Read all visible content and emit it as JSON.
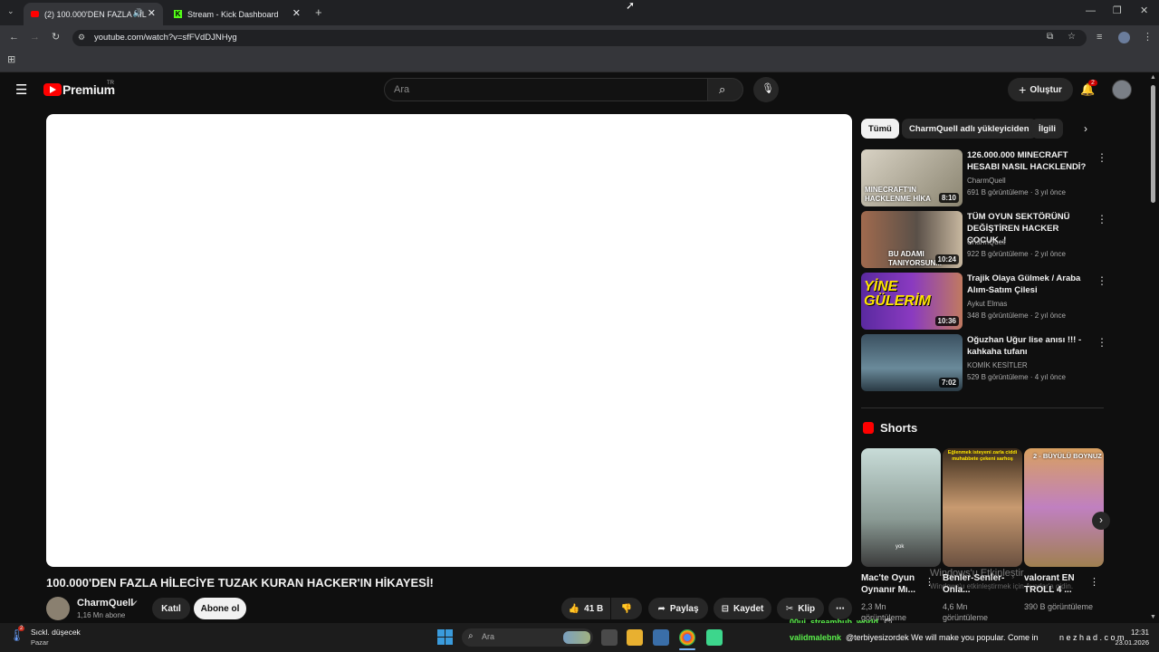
{
  "browser": {
    "tabs": [
      {
        "title": "(2) 100.000'DEN FAZLA HİL"
      },
      {
        "title": "Stream - Kick Dashboard"
      }
    ],
    "url": "youtube.com/watch?v=sfFVdDJNHyg"
  },
  "youtube": {
    "logo_text": "Premium",
    "logo_sup": "TR",
    "search_placeholder": "Ara",
    "create_label": "Oluştur",
    "notif_count": "2",
    "video": {
      "title": "100.000'DEN FAZLA HİLECİYE TUZAK KURAN HACKER'IN HİKAYESİ!",
      "channel": "CharmQuell",
      "subscribers": "1,16 Mn abone",
      "join_label": "Katıl",
      "subscribe_label": "Abone ol",
      "likes": "41 B",
      "share_label": "Paylaş",
      "save_label": "Kaydet",
      "clip_label": "Klip"
    },
    "chips": [
      "Tümü",
      "CharmQuell adlı yükleyiciden",
      "İlgili"
    ],
    "recommendations": [
      {
        "title": "126.000.000 MINECRAFT HESABI NASIL HACKLENDİ?",
        "channel": "CharmQuell",
        "meta": "691 B görüntüleme · 3 yıl önce",
        "duration": "8:10",
        "thumb_text": "MINECRAFT'IN HACKLENME HİKA"
      },
      {
        "title": "TÜM OYUN SEKTÖRÜNÜ DEĞİŞTİREN HACKER ÇOCUK..!",
        "channel": "CharmQuell",
        "meta": "922 B görüntüleme · 2 yıl önce",
        "duration": "10:24",
        "thumb_text": "BU ADAMI TANIYORSUN..."
      },
      {
        "title": "Trajik Olaya Gülmek / Araba Alım-Satım Çilesi",
        "channel": "Aykut Elmas",
        "meta": "348 B görüntüleme · 2 yıl önce",
        "duration": "10:36",
        "thumb_text": "YİNE GÜLERİM"
      },
      {
        "title": "Oğuzhan Uğur lise anısı !!! - kahkaha tufanı",
        "channel": "KOMİK KESİTLER",
        "meta": "529 B görüntüleme · 4 yıl önce",
        "duration": "7:02",
        "thumb_text": ""
      }
    ],
    "shorts_heading": "Shorts",
    "shorts": [
      {
        "title": "Mac'te Oyun Oynanır Mı...",
        "views": "2,3 Mn görüntüleme",
        "thumb_text": "yok"
      },
      {
        "title": "Benler-Senler-Onla...",
        "views": "4,6 Mn görüntüleme",
        "thumb_text": "Eğlenmek isteyeni zarla ciddi muhabbete çekeni sarhoş"
      },
      {
        "title": "valorant EN TROLL 4 ...",
        "views": "390 B görüntüleme",
        "thumb_text": "2 - BÜYÜLÜ BOYNUZ"
      }
    ],
    "watermark": "Windows'u Etkinleştir",
    "watermark_sub": "Windows'u etkinleştirmek için Ayarlar'a gidin."
  },
  "overlay": {
    "chat_user1": "00ui_streamhub_world",
    "chat_user2": "validmalebnk",
    "chat_msg": "@terbiyesizordek We will make you popular. Come in",
    "chat_tail": "n e z h a d . c o m"
  },
  "taskbar": {
    "weather_title": "Sıckl. düşecek",
    "weather_sub": "Pazar",
    "weather_badge": "2",
    "search_placeholder": "Ara",
    "time": "12:31",
    "date": "23.01.2026"
  },
  "colors": {
    "yt_red": "#ff0000",
    "kick_green": "#53fc18",
    "chat_green": "#5bf14b"
  }
}
